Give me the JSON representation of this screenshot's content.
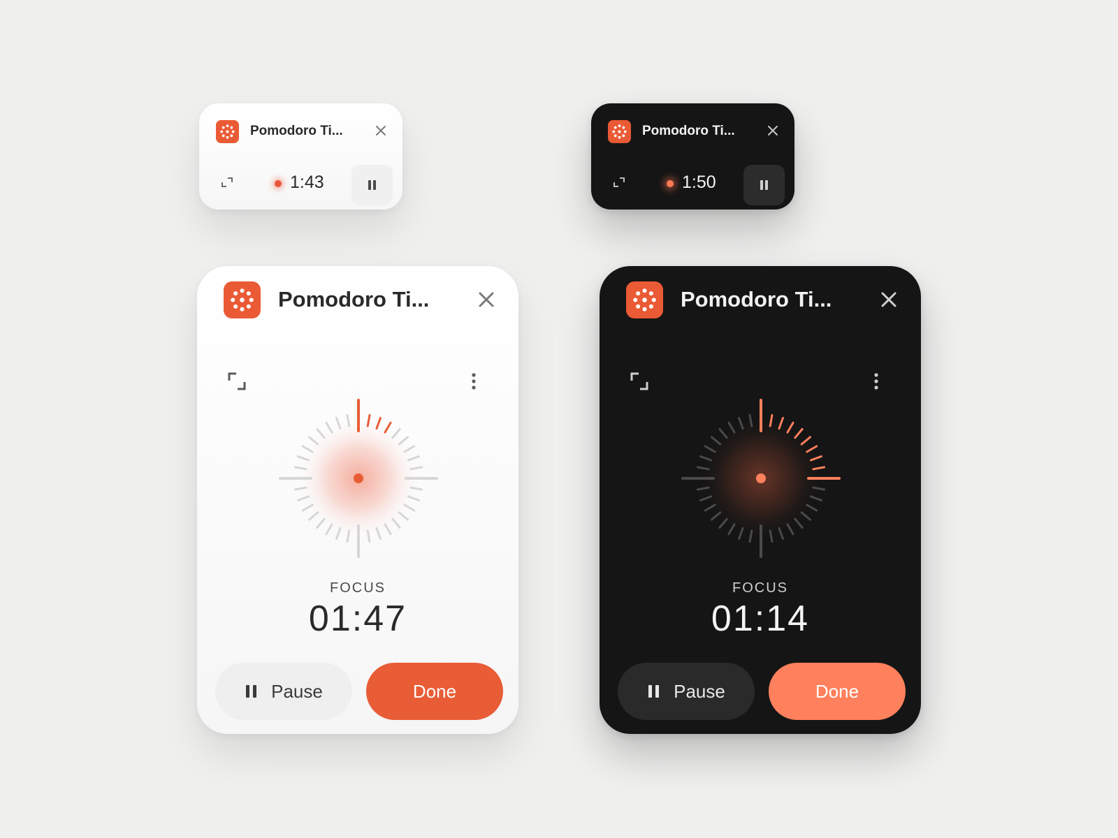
{
  "app": {
    "name_truncated": "Pomodoro Ti..."
  },
  "colors": {
    "accent_light": "#e85d36",
    "accent_dark": "#ff805c",
    "dial_light_track": "#d6d6d6",
    "dial_dark_track": "#4a4a4a"
  },
  "icons": {
    "app": "pomodoro-app-icon",
    "close": "close-icon",
    "expand": "expand-icon",
    "more": "more-vertical-icon",
    "pause": "pause-icon",
    "status_dot": "recording-dot-icon"
  },
  "mini_light": {
    "title": "Pomodoro Ti...",
    "time": "1:43"
  },
  "mini_dark": {
    "title": "Pomodoro Ti...",
    "time": "1:50"
  },
  "big_light": {
    "title": "Pomodoro Ti...",
    "mode_label": "FOCUS",
    "time": "01:47",
    "pause_label": "Pause",
    "done_label": "Done",
    "dial_progress": 0.1
  },
  "big_dark": {
    "title": "Pomodoro Ti...",
    "mode_label": "FOCUS",
    "time": "01:14",
    "pause_label": "Pause",
    "done_label": "Done",
    "dial_progress": 0.25
  }
}
